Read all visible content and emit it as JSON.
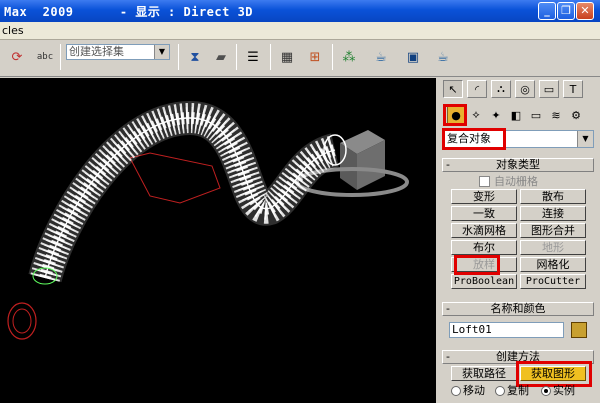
{
  "window": {
    "title": "Max  2009      - 显示 : Direct 3D",
    "min_label": "_",
    "max_label": "❐",
    "close_label": "✕"
  },
  "menu": {
    "partial_item": "cles"
  },
  "toolbar": {
    "selection_set_placeholder": "创建选择集"
  },
  "panel": {
    "dropdown_value": "复合对象",
    "object_type": {
      "header": "对象类型",
      "autogrid_label": "自动栅格",
      "buttons": [
        "变形",
        "散布",
        "一致",
        "连接",
        "水滴网格",
        "图形合并",
        "布尔",
        "地形",
        "放样",
        "网格化",
        "ProBoolean",
        "ProCutter"
      ]
    },
    "name_color": {
      "header": "名称和颜色",
      "name_value": "Loft01"
    },
    "creation_method": {
      "header": "创建方法",
      "get_path_label": "获取路径",
      "get_shape_label": "获取图形",
      "radio_move": "移动",
      "radio_copy": "复制",
      "radio_instance": "实例"
    }
  },
  "colors": {
    "highlight": "#e00000",
    "viewport": "#000000",
    "panel": "#d4d0c8",
    "active_button": "#f0c020"
  }
}
